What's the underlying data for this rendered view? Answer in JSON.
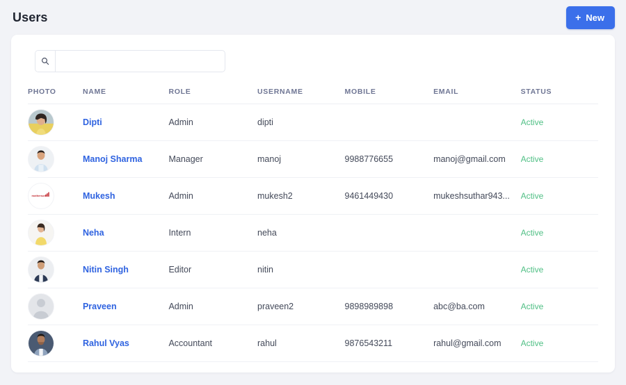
{
  "header": {
    "title": "Users",
    "new_button_label": "New",
    "new_button_icon": "plus-icon",
    "accent_color": "#3b6fea"
  },
  "search": {
    "icon": "search-icon",
    "value": "",
    "placeholder": ""
  },
  "table": {
    "columns": [
      "PHOTO",
      "NAME",
      "ROLE",
      "USERNAME",
      "MOBILE",
      "EMAIL",
      "STATUS"
    ],
    "status_color": "#4fbf84",
    "name_link_color": "#2f63e0",
    "rows": [
      {
        "photo": "avatar-photo-dipti",
        "name": "Dipti",
        "role": "Admin",
        "username": "dipti",
        "mobile": "",
        "email": "",
        "status": "Active"
      },
      {
        "photo": "avatar-photo-manoj",
        "name": "Manoj Sharma",
        "role": "Manager",
        "username": "manoj",
        "mobile": "9988776655",
        "email": "manoj@gmail.com",
        "status": "Active"
      },
      {
        "photo": "avatar-logo-motherson",
        "name": "Mukesh",
        "role": "Admin",
        "username": "mukesh2",
        "mobile": "9461449430",
        "email": "mukeshsuthar943...",
        "status": "Active"
      },
      {
        "photo": "avatar-photo-neha",
        "name": "Neha",
        "role": "Intern",
        "username": "neha",
        "mobile": "",
        "email": "",
        "status": "Active"
      },
      {
        "photo": "avatar-photo-nitin",
        "name": "Nitin Singh",
        "role": "Editor",
        "username": "nitin",
        "mobile": "",
        "email": "",
        "status": "Active"
      },
      {
        "photo": "avatar-placeholder-praveen",
        "name": "Praveen",
        "role": "Admin",
        "username": "praveen2",
        "mobile": "9898989898",
        "email": "abc@ba.com",
        "status": "Active"
      },
      {
        "photo": "avatar-photo-rahul",
        "name": "Rahul Vyas",
        "role": "Accountant",
        "username": "rahul",
        "mobile": "9876543211",
        "email": "rahul@gmail.com",
        "status": "Active"
      }
    ]
  }
}
